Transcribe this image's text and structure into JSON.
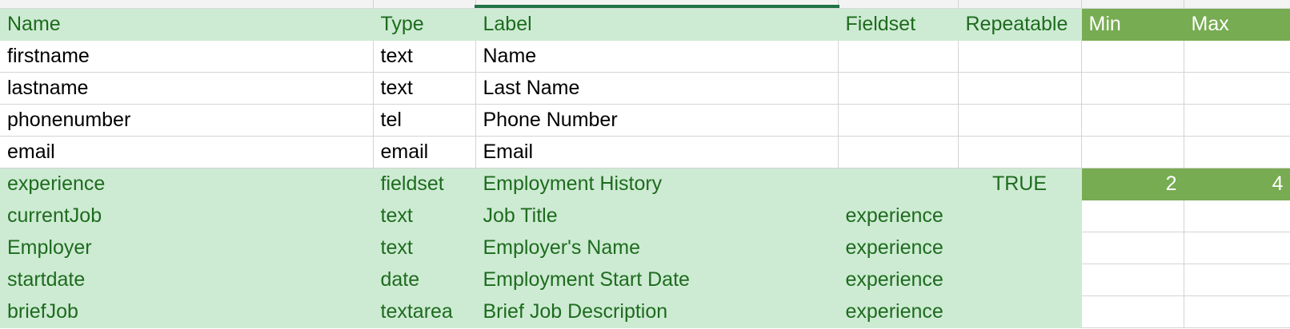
{
  "sheet": {
    "headers": {
      "name": "Name",
      "type": "Type",
      "label": "Label",
      "fieldset": "Fieldset",
      "repeatable": "Repeatable",
      "min": "Min",
      "max": "Max"
    },
    "rows": [
      {
        "name": "firstname",
        "type": "text",
        "label": "Name",
        "fieldset": "",
        "repeatable": "",
        "min": "",
        "max": ""
      },
      {
        "name": "lastname",
        "type": "text",
        "label": "Last Name",
        "fieldset": "",
        "repeatable": "",
        "min": "",
        "max": ""
      },
      {
        "name": "phonenumber",
        "type": "tel",
        "label": "Phone Number",
        "fieldset": "",
        "repeatable": "",
        "min": "",
        "max": ""
      },
      {
        "name": "email",
        "type": "email",
        "label": "Email",
        "fieldset": "",
        "repeatable": "",
        "min": "",
        "max": ""
      },
      {
        "name": "experience",
        "type": "fieldset",
        "label": "Employment History",
        "fieldset": "",
        "repeatable": "TRUE",
        "min": "2",
        "max": "4"
      },
      {
        "name": "currentJob",
        "type": "text",
        "label": "Job Title",
        "fieldset": "experience",
        "repeatable": "",
        "min": "",
        "max": ""
      },
      {
        "name": "Employer",
        "type": "text",
        "label": "Employer's Name",
        "fieldset": "experience",
        "repeatable": "",
        "min": "",
        "max": ""
      },
      {
        "name": "startdate",
        "type": "date",
        "label": "Employment Start Date",
        "fieldset": "experience",
        "repeatable": "",
        "min": "",
        "max": ""
      },
      {
        "name": "briefJob",
        "type": "textarea",
        "label": "Brief Job Description",
        "fieldset": "experience",
        "repeatable": "",
        "min": "",
        "max": ""
      }
    ]
  },
  "colors": {
    "light_green_fill": "#cdebd3",
    "dark_green_fill": "#77ac52",
    "green_text": "#1e6b1e",
    "selection_accent": "#217346",
    "gridline": "#d4d4d4"
  }
}
